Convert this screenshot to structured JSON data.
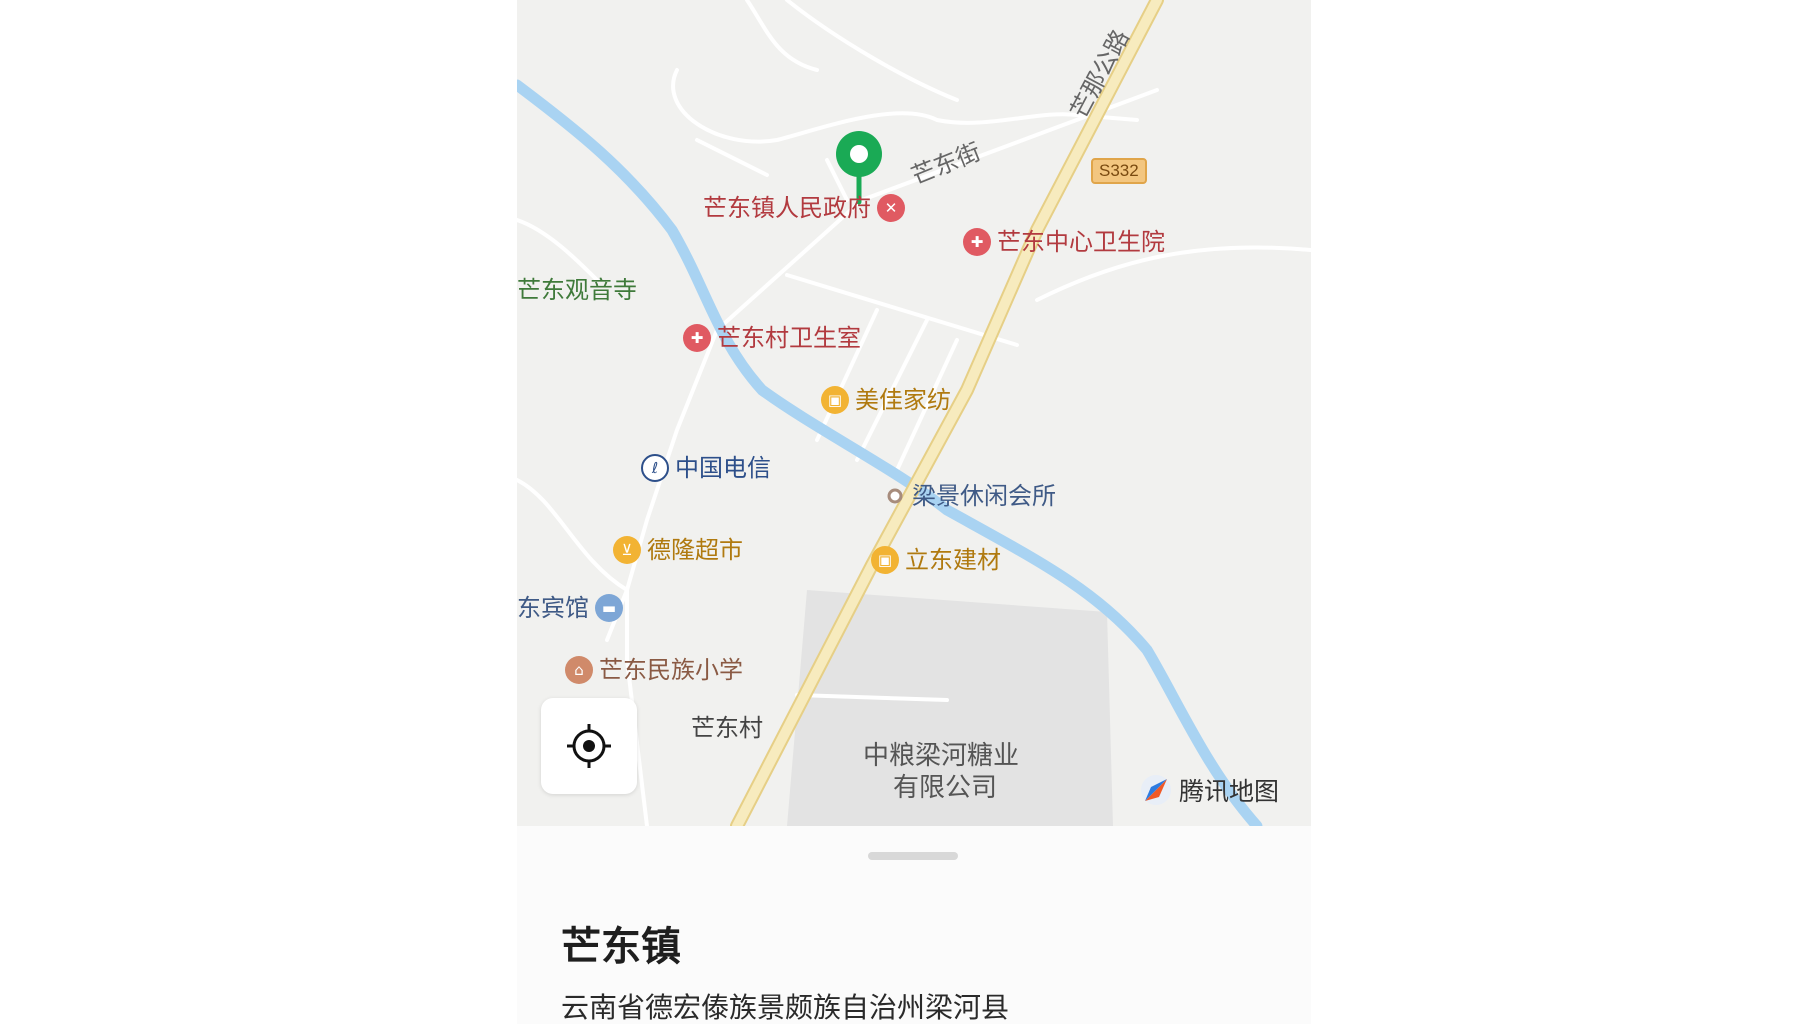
{
  "map": {
    "street_label": "芒东街",
    "highway_label": "芒那公路",
    "route_shield": "S332",
    "village_label": "芒东村",
    "factory_label_line1": "中粮梁河糖业",
    "factory_label_line2": "有限公司",
    "brand": "腾讯地图",
    "pois": {
      "gov": "芒东镇人民政府",
      "hospital": "芒东中心卫生院",
      "temple": "芒东观音寺",
      "clinic": "芒东村卫生室",
      "meijia": "美佳家纺",
      "telecom": "中国电信",
      "leisure": "梁景休闲会所",
      "delong": "德隆超市",
      "lidong": "立东建材",
      "hotel": "东宾馆",
      "school": "芒东民族小学"
    }
  },
  "sheet": {
    "title": "芒东镇",
    "address": "云南省德宏傣族景颇族自治州梁河县"
  },
  "colors": {
    "river": "#a9d3f2",
    "highway": "#f3e2a4",
    "marker": "#1aaa55",
    "poi_red": "#e05a62",
    "poi_orange": "#f2b333"
  },
  "icons": {
    "marker": "map-pin-icon",
    "locate": "crosshair-icon",
    "gov": "government-icon",
    "hospital": "hospital-icon",
    "shop": "shopping-bag-icon",
    "telecom": "telecom-logo-icon",
    "cart": "cart-icon",
    "hotel": "bed-icon",
    "school": "school-icon",
    "brand": "tencent-map-logo-icon"
  }
}
